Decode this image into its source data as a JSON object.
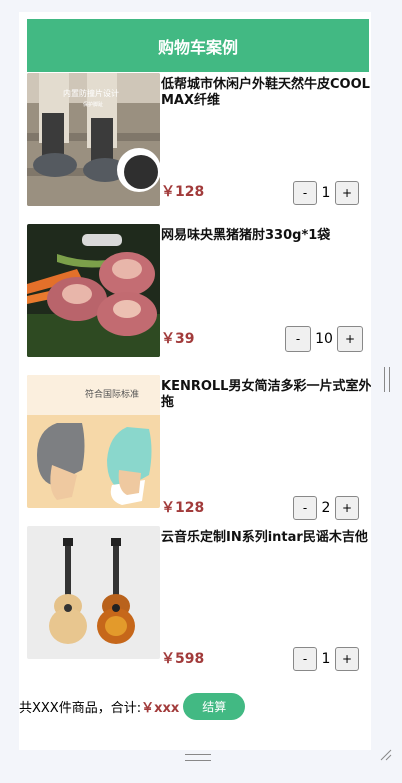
{
  "header": {
    "title": "购物车案例"
  },
  "items": [
    {
      "name": "低帮城市休闲户外鞋天然牛皮COOLMAX纤维",
      "price": "￥128",
      "quantity": "1",
      "minus_label": "-",
      "plus_label": "+",
      "image_text": "内置防撞片设计",
      "image_subtext": "保护脚趾"
    },
    {
      "name": "网易味央黑猪猪肘330g*1袋",
      "price": "￥39",
      "quantity": "10",
      "minus_label": "-",
      "plus_label": "+"
    },
    {
      "name": "KENROLL男女简洁多彩一片式室外拖",
      "price": "￥128",
      "quantity": "2",
      "minus_label": "-",
      "plus_label": "+",
      "image_text": "符合国际标准"
    },
    {
      "name": "云音乐定制IN系列intar民谣木吉他",
      "price": "￥598",
      "quantity": "1",
      "minus_label": "-",
      "plus_label": "+"
    }
  ],
  "footer": {
    "summary_label": "共XXX件商品，合计:",
    "total": "￥xxx",
    "checkout_label": "结算"
  },
  "colors": {
    "accent": "#42b983",
    "price": "#a23b3b"
  }
}
